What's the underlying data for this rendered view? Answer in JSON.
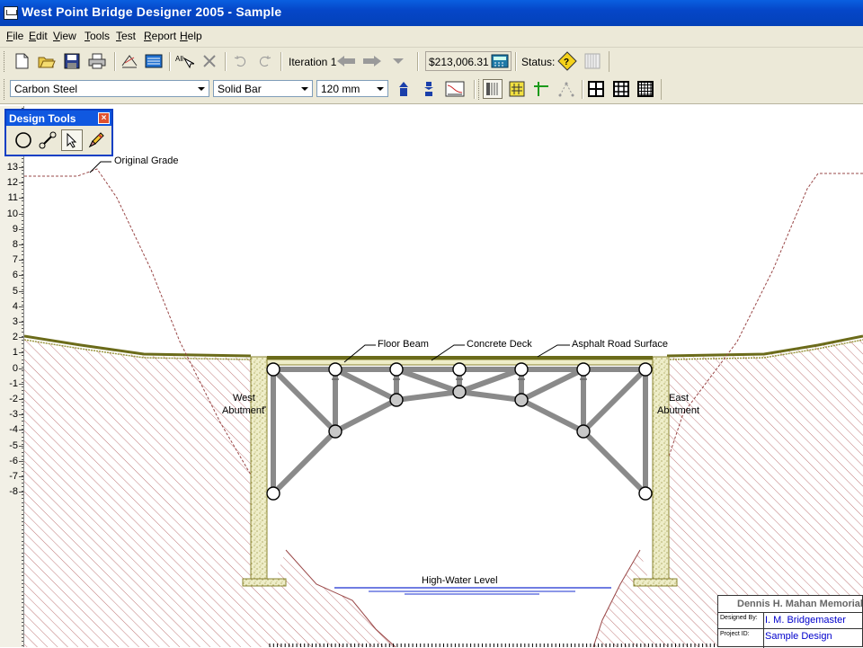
{
  "window": {
    "title": "West Point Bridge Designer 2005 - Sample"
  },
  "menu": {
    "items": [
      "File",
      "Edit",
      "View",
      "Tools",
      "Test",
      "Report",
      "Help"
    ]
  },
  "toolbar": {
    "iteration_label": "Iteration 1",
    "cost": "$213,006.31",
    "status_label": "Status:"
  },
  "member_toolbar": {
    "material": "Carbon Steel",
    "section": "Solid Bar",
    "size": "120 mm"
  },
  "design_tools": {
    "title": "Design Tools",
    "close": "×",
    "tools": [
      "joint-tool",
      "member-tool",
      "select-tool",
      "eraser-tool"
    ],
    "active": "select-tool"
  },
  "ruler": {
    "labels": [
      "13",
      "12",
      "11",
      "10",
      "9",
      "8",
      "7",
      "6",
      "5",
      "4",
      "3",
      "2",
      "1",
      "0",
      "-1",
      "-2",
      "-3",
      "-4",
      "-5",
      "-6",
      "-7",
      "-8"
    ]
  },
  "drawing": {
    "labels": {
      "original_grade": "Original Grade",
      "floor_beam": "Floor Beam",
      "concrete_deck": "Concrete Deck",
      "asphalt": "Asphalt Road Surface",
      "west_abutment_1": "West",
      "west_abutment_2": "Abutment",
      "east_abutment_1": "East",
      "east_abutment_2": "Abutment",
      "high_water": "High-Water Level"
    }
  },
  "title_block": {
    "organization": "Dennis H. Mahan Memorial",
    "designed_by_label": "Designed By:",
    "designed_by": "I. M. Bridgemaster",
    "project_id_label": "Project ID:",
    "project_id": "Sample Design"
  }
}
